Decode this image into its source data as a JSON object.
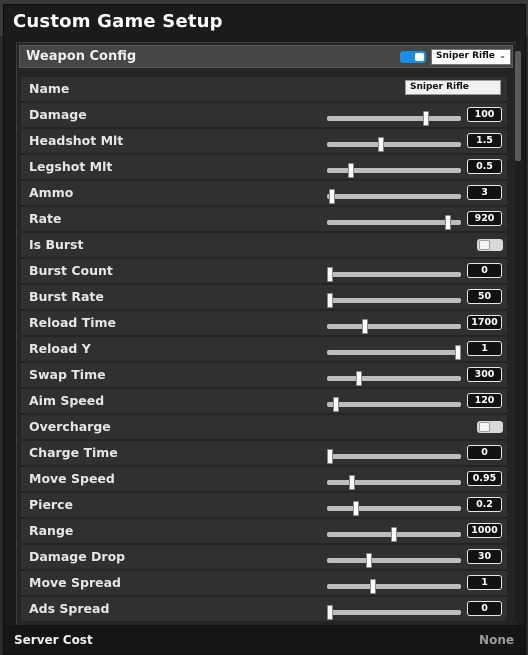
{
  "window": {
    "title": "Custom Game Setup"
  },
  "panel": {
    "header_label": "Weapon Config",
    "enabled": true,
    "weapon_select": {
      "selected": "Sniper Rifle"
    }
  },
  "name_row": {
    "label": "Name",
    "value": "Sniper Rifle"
  },
  "rows": [
    {
      "label": "Damage",
      "type": "slider",
      "value": "100",
      "fill": 0.74
    },
    {
      "label": "Headshot Mlt",
      "type": "slider",
      "value": "1.5",
      "fill": 0.4
    },
    {
      "label": "Legshot Mlt",
      "type": "slider",
      "value": "0.5",
      "fill": 0.18
    },
    {
      "label": "Ammo",
      "type": "slider",
      "value": "3",
      "fill": 0.04
    },
    {
      "label": "Rate",
      "type": "slider",
      "value": "920",
      "fill": 0.9
    },
    {
      "label": "Is Burst",
      "type": "toggle",
      "on": false
    },
    {
      "label": "Burst Count",
      "type": "slider",
      "value": "0",
      "fill": 0.02
    },
    {
      "label": "Burst Rate",
      "type": "slider",
      "value": "50",
      "fill": 0.02
    },
    {
      "label": "Reload Time",
      "type": "slider",
      "value": "1700",
      "fill": 0.28
    },
    {
      "label": "Reload Y",
      "type": "slider",
      "value": "1",
      "fill": 0.98
    },
    {
      "label": "Swap Time",
      "type": "slider",
      "value": "300",
      "fill": 0.24
    },
    {
      "label": "Aim Speed",
      "type": "slider",
      "value": "120",
      "fill": 0.07
    },
    {
      "label": "Overcharge",
      "type": "toggle",
      "on": false
    },
    {
      "label": "Charge Time",
      "type": "slider",
      "value": "0",
      "fill": 0.02
    },
    {
      "label": "Move Speed",
      "type": "slider",
      "value": "0.95",
      "fill": 0.19
    },
    {
      "label": "Pierce",
      "type": "slider",
      "value": "0.2",
      "fill": 0.22
    },
    {
      "label": "Range",
      "type": "slider",
      "value": "1000",
      "fill": 0.5
    },
    {
      "label": "Damage Drop",
      "type": "slider",
      "value": "30",
      "fill": 0.31
    },
    {
      "label": "Move Spread",
      "type": "slider",
      "value": "1",
      "fill": 0.34
    },
    {
      "label": "Ads Spread",
      "type": "slider",
      "value": "0",
      "fill": 0.02
    }
  ],
  "footer": {
    "label": "Server Cost",
    "value": "None"
  },
  "icons": {
    "dropdown": "chevron-down-icon"
  },
  "colors": {
    "toggle_on": "#1a90e5",
    "background": "#1b1b1b"
  }
}
